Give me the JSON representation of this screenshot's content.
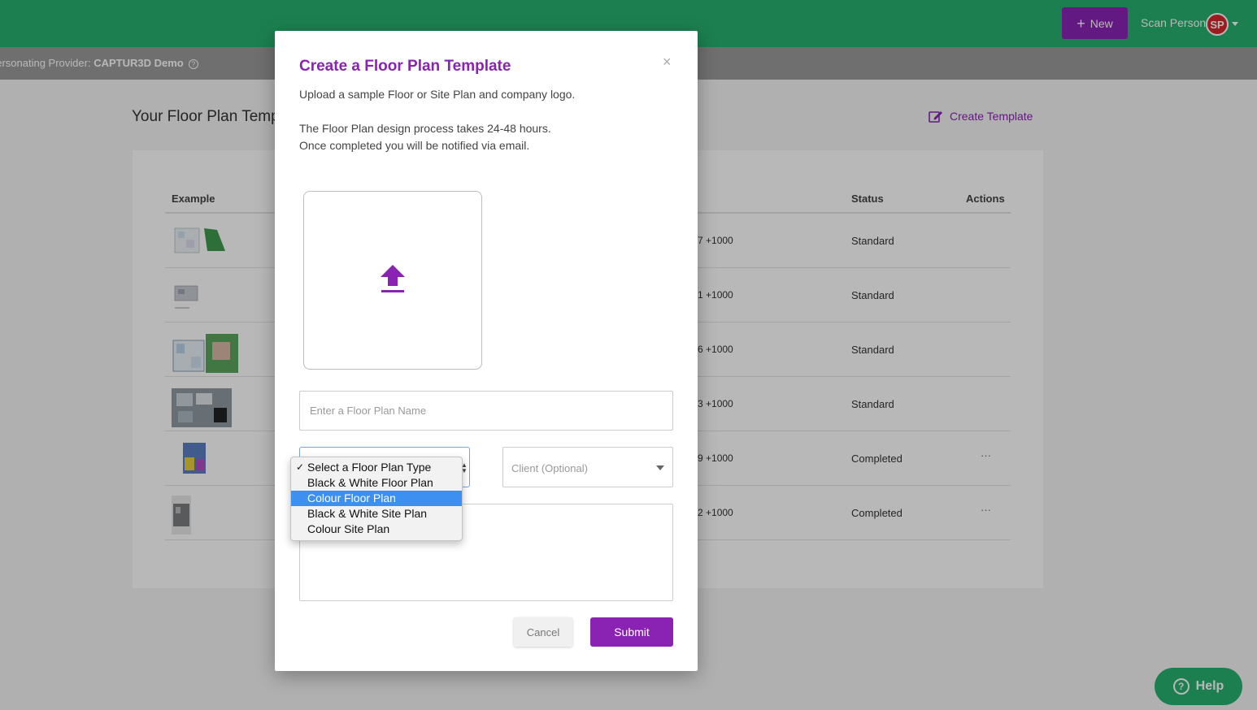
{
  "topbar": {
    "new_button": "New",
    "user_name": "Scan Person",
    "avatar_initials": "SP"
  },
  "impersonation": {
    "label": "personating Provider: ",
    "provider": "CAPTUR3D Demo"
  },
  "page": {
    "title": "Your Floor Plan Templ",
    "create_template": "Create Template"
  },
  "table": {
    "headers": {
      "example": "Example",
      "status": "Status",
      "actions": "Actions"
    },
    "rows": [
      {
        "price": "7 +1000",
        "status": "Standard",
        "actions": ""
      },
      {
        "price": "1 +1000",
        "status": "Standard",
        "actions": ""
      },
      {
        "price": "6 +1000",
        "status": "Standard",
        "actions": ""
      },
      {
        "price": "3 +1000",
        "status": "Standard",
        "actions": ""
      },
      {
        "price": "9 +1000",
        "status": "Completed",
        "actions": "···"
      },
      {
        "price": "2 +1000",
        "status": "Completed",
        "actions": "···"
      }
    ]
  },
  "modal": {
    "title": "Create a Floor Plan Template",
    "close": "×",
    "intro": "Upload a sample Floor or Site Plan and company logo.",
    "process_line1": "The Floor Plan design process takes 24-48 hours.",
    "process_line2": "Once completed you will be notified via email.",
    "name_placeholder": "Enter a Floor Plan Name",
    "client_placeholder": "Client (Optional)",
    "cancel": "Cancel",
    "submit": "Submit"
  },
  "type_dropdown": {
    "options": [
      "Select a Floor Plan Type",
      "Black & White Floor Plan",
      "Colour Floor Plan",
      "Black & White Site Plan",
      "Colour Site Plan"
    ],
    "checked": "✓"
  },
  "help_button": "Help",
  "colors": {
    "brand_green": "#27b06e",
    "brand_purple": "#8a23b4",
    "highlight": "#3d8ff0"
  }
}
